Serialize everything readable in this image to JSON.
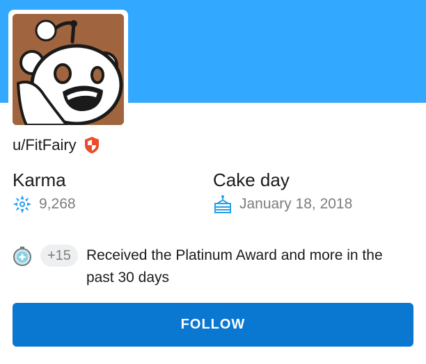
{
  "profile": {
    "username": "u/FitFairy",
    "accent_color": "#33a8ff"
  },
  "karma": {
    "label": "Karma",
    "value": "9,268"
  },
  "cake_day": {
    "label": "Cake day",
    "value": "January 18, 2018"
  },
  "trophies": {
    "count": "+15",
    "text": "Received the Platinum Award and more in the past 30 days"
  },
  "actions": {
    "follow_label": "FOLLOW",
    "follow_color": "#0a77d1"
  }
}
